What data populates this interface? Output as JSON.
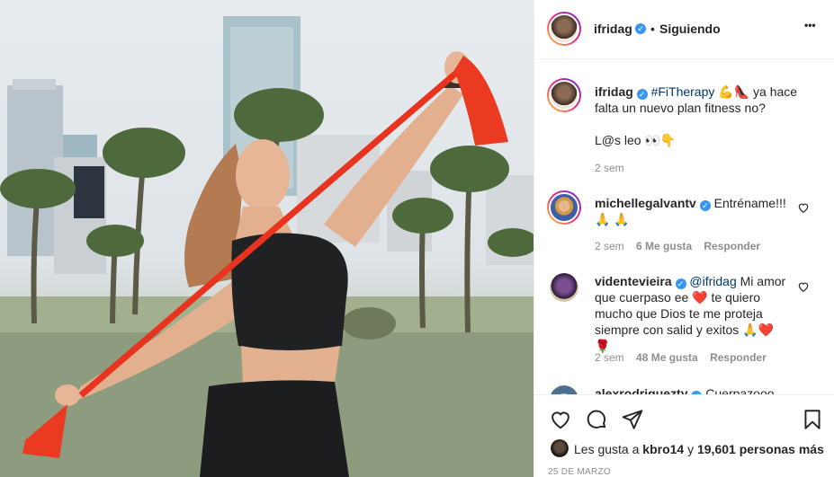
{
  "post": {
    "username": "ifridag",
    "follow_status": "Siguiendo",
    "separator": "•",
    "more_label": "•••"
  },
  "caption": {
    "username": "ifridag",
    "hashtag": "#FiTherapy",
    "text_part1": "ya hace falta un nuevo plan fitness no?",
    "emojis_inline": "💪👠",
    "line2": "L@s leo",
    "line2_emojis": "👀👇",
    "time": "2 sem"
  },
  "comments": [
    {
      "username": "michellegalvantv",
      "text": "Entréname!!!",
      "emojis": "🙏 🙏",
      "time": "2 sem",
      "likes": "6 Me gusta",
      "reply": "Responder"
    },
    {
      "username": "videntevieira",
      "mention": "@ifridag",
      "text_a": "Mi amor que cuerpaso ee",
      "text_b": "te quiero mucho que Dios te me proteja siempre con salid y exitos",
      "emoji_a": "❤️",
      "emojis_end": "🙏❤️🌹",
      "time": "2 sem",
      "likes": "48 Me gusta",
      "reply": "Responder"
    },
    {
      "username": "alexrodriguezty",
      "text": "Cuerpazooo"
    }
  ],
  "footer": {
    "likes_prefix": "Les gusta a",
    "likes_user": "kbro14",
    "likes_mid": "y",
    "likes_count": "19,601 personas más",
    "date": "25 DE MARZO"
  },
  "icons": {
    "like": "heart-icon",
    "comment": "comment-icon",
    "share": "share-icon",
    "save": "bookmark-icon"
  },
  "colors": {
    "verified": "#3897f0",
    "mention": "#00376b",
    "band": "#e8331f",
    "muted": "#8e8e8e"
  }
}
